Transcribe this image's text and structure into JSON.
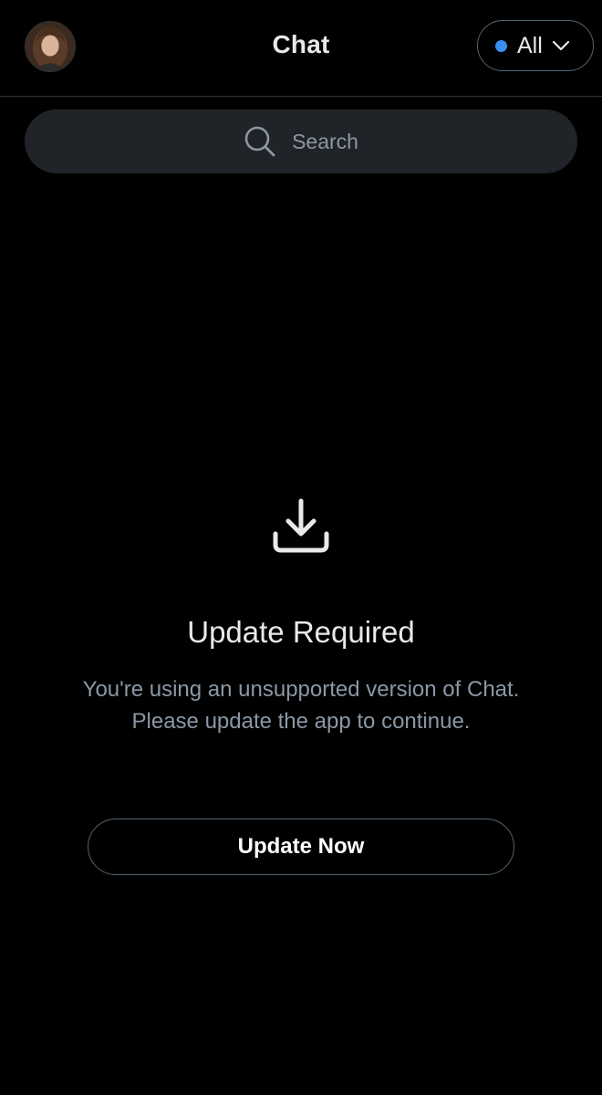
{
  "header": {
    "title": "Chat",
    "filter": {
      "label": "All",
      "dot_color": "#3b8ff0"
    }
  },
  "search": {
    "placeholder": "Search"
  },
  "notice": {
    "icon": "download-icon",
    "heading": "Update Required",
    "message": "You're using an unsupported version of Chat. Please update the app to continue.",
    "button_label": "Update Now"
  },
  "colors": {
    "background": "#000000",
    "text_primary": "#e7e9ea",
    "text_secondary": "#8b98a5",
    "border": "#536471",
    "search_bg": "#202327",
    "accent": "#3b8ff0"
  }
}
